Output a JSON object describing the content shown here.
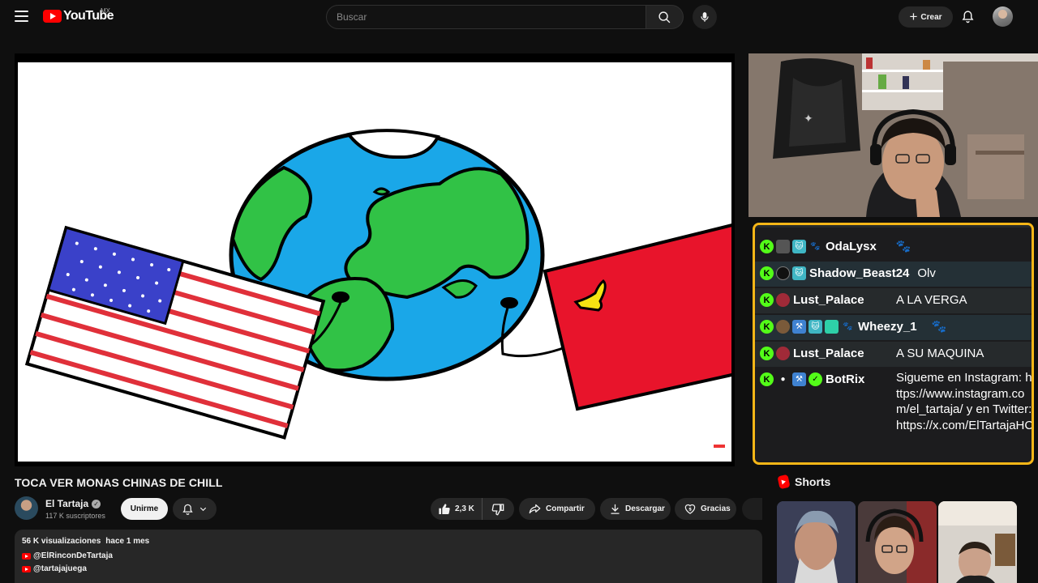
{
  "header": {
    "logo_text": "YouTube",
    "region": "MX",
    "search_placeholder": "Buscar",
    "create_label": "Crear"
  },
  "chat": {
    "messages": [
      {
        "user": "OdaLysx",
        "message": ""
      },
      {
        "user": "Shadow_Beast24",
        "message": "Olv"
      },
      {
        "user": "Lust_Palace",
        "message": "A LA VERGA"
      },
      {
        "user": "Wheezy_1",
        "message": ""
      },
      {
        "user": "Lust_Palace",
        "message": "A SU MAQUINA"
      },
      {
        "user": "BotRix",
        "message": "Sigueme en Instagram: https://www.instagram.com/el_tartaja/ y en Twitter: https://x.com/ElTartajaHC"
      }
    ]
  },
  "video": {
    "title": "TOCA VER MONAS CHINAS DE CHILL",
    "channel": {
      "name": "El Tartaja",
      "subscribers": "117 K suscriptores"
    },
    "join_label": "Unirme",
    "likes": "2,3 K",
    "share_label": "Compartir",
    "download_label": "Descargar",
    "thanks_label": "Gracias"
  },
  "description": {
    "views": "56 K visualizaciones",
    "date": "hace 1 mes",
    "links": [
      "@ElRinconDeTartaja",
      "@tartajajuega"
    ]
  },
  "sidebar": {
    "shorts_title": "Shorts"
  },
  "colors": {
    "accent": "#ff0000",
    "chat_border": "#f6b617",
    "kick_green": "#53fc18",
    "background": "#0f0f0f"
  }
}
